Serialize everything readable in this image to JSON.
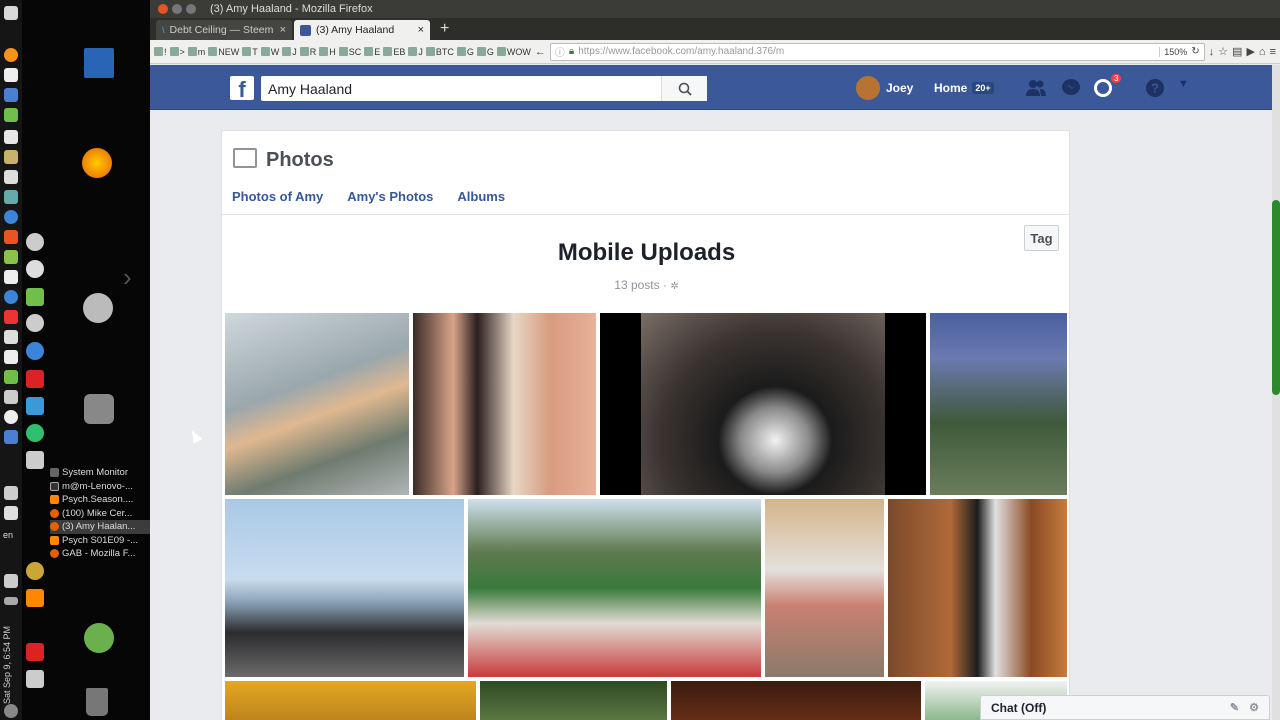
{
  "window": {
    "title": "(3) Amy Haaland - Mozilla Firefox"
  },
  "tabs": [
    {
      "label": "Debt Ceiling — Steem"
    },
    {
      "label": "(3) Amy Haaland"
    }
  ],
  "bookmarks": [
    "!",
    ">",
    "m",
    "NEW",
    "T",
    "W",
    "J",
    "R",
    "H",
    "SC",
    "E",
    "EB",
    "J",
    "BTC",
    "G",
    "G",
    "WOW"
  ],
  "url": {
    "value": "https://www.facebook.com/amy.haaland.376/m",
    "zoom": "150%"
  },
  "taskbar": {
    "windows": [
      "System Monitor",
      "m@m-Lenovo-...",
      "Psych.Season....",
      "(100) Mike Cer...",
      "(3) Amy Haalan...",
      "Psych S01E09 -...",
      "GAB - Mozilla F..."
    ],
    "lang": "en",
    "clock": "Sat Sep 9, 6:54 PM"
  },
  "fb": {
    "search_value": "Amy Haaland",
    "user_name": "Joey",
    "home_label": "Home",
    "home_count": "20+",
    "notif_count": "3"
  },
  "photos": {
    "header": "Photos",
    "tabs": [
      "Photos of Amy",
      "Amy's Photos",
      "Albums"
    ],
    "tag_label": "Tag",
    "album_title": "Mobile Uploads",
    "album_meta": "13 posts ·"
  },
  "chat": {
    "label": "Chat (Off)"
  },
  "colors": {
    "fb_blue": "#3b5998",
    "link": "#365899"
  }
}
